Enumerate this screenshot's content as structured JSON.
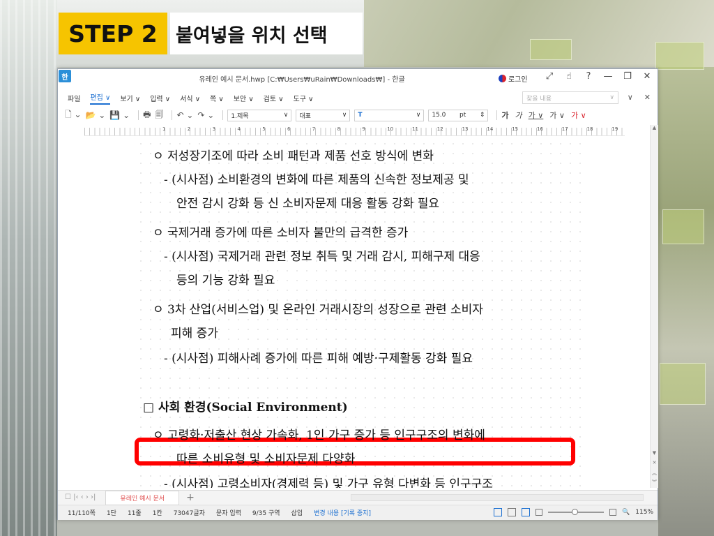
{
  "slide": {
    "step_label": "STEP 2",
    "step_title": "붙여넣을 위치 선택"
  },
  "window": {
    "app_icon": "한",
    "title": "유레인 예시 문서.hwp [C:₩Users₩uRain₩Downloads₩] - 한글",
    "login_label": "로그인",
    "controls": [
      "⤢",
      "☝",
      "?",
      "—",
      "❐",
      "✕"
    ]
  },
  "menu": {
    "items": [
      "파일",
      "편집 ∨",
      "보기 ∨",
      "입력 ∨",
      "서식 ∨",
      "쪽 ∨",
      "보안 ∨",
      "검토 ∨",
      "도구 ∨"
    ],
    "active_index": 1,
    "find_placeholder": "찾을 내용",
    "right_icons": [
      "∨",
      "✕"
    ]
  },
  "toolbar": {
    "style_value": "1.제목",
    "font_value": "대표",
    "font_icon": "T",
    "size_value": "15.0",
    "size_unit": "pt",
    "format_labels": [
      "가",
      "가",
      "가 ∨",
      "가 ∨",
      "가 ∨"
    ]
  },
  "ruler": {
    "numbers": [
      "1",
      "2",
      "3",
      "4",
      "5",
      "6",
      "7",
      "8",
      "9",
      "10",
      "11",
      "12",
      "13",
      "14",
      "15",
      "16",
      "17",
      "18",
      "19"
    ]
  },
  "document": {
    "lines": [
      "ㅇ 저성장기조에 따라 소비 패턴과 제품 선호 방식에 변화",
      "- (시사점) 소비환경의 변화에 따른 제품의 신속한 정보제공 및",
      "안전 감시 강화 등 신 소비자문제 대응 활동 강화 필요",
      "ㅇ 국제거래 증가에 따른 소비자 불만의 급격한 증가",
      "- (시사점) 국제거래 관련 정보 취득 및 거래 감시, 피해구제 대응",
      "등의 기능 강화 필요",
      "ㅇ 3차 산업(서비스업) 및 온라인 거래시장의 성장으로 관련 소비자",
      "피해 증가",
      "- (시사점) 피해사례 증가에 따른 피해 예방·구제활동 강화 필요",
      "□ 사회 환경(Social Environment)",
      "ㅇ 고령화·저출산 현상 가속화, 1인 가구 증가 등 인구구조의 변화에",
      "따른 소비유형 및 소비자문제 다양화",
      "- (시사점) 고령소비자(경제력 등) 및 가구 유형 다변화 등 인구구조"
    ]
  },
  "tabs": {
    "nav": "☐  |‹  ‹  ›  ›|",
    "document_tab": "유레인 예시 문서",
    "add": "+"
  },
  "status": {
    "page": "11/110쪽",
    "column": "1단",
    "line": "11줄",
    "col": "1칸",
    "chars": "73047글자",
    "mode": "문자 입력",
    "section": "9/35 구역",
    "insert": "삽입",
    "track": "변경 내용 [기록 중지]",
    "zoom": "115%"
  }
}
